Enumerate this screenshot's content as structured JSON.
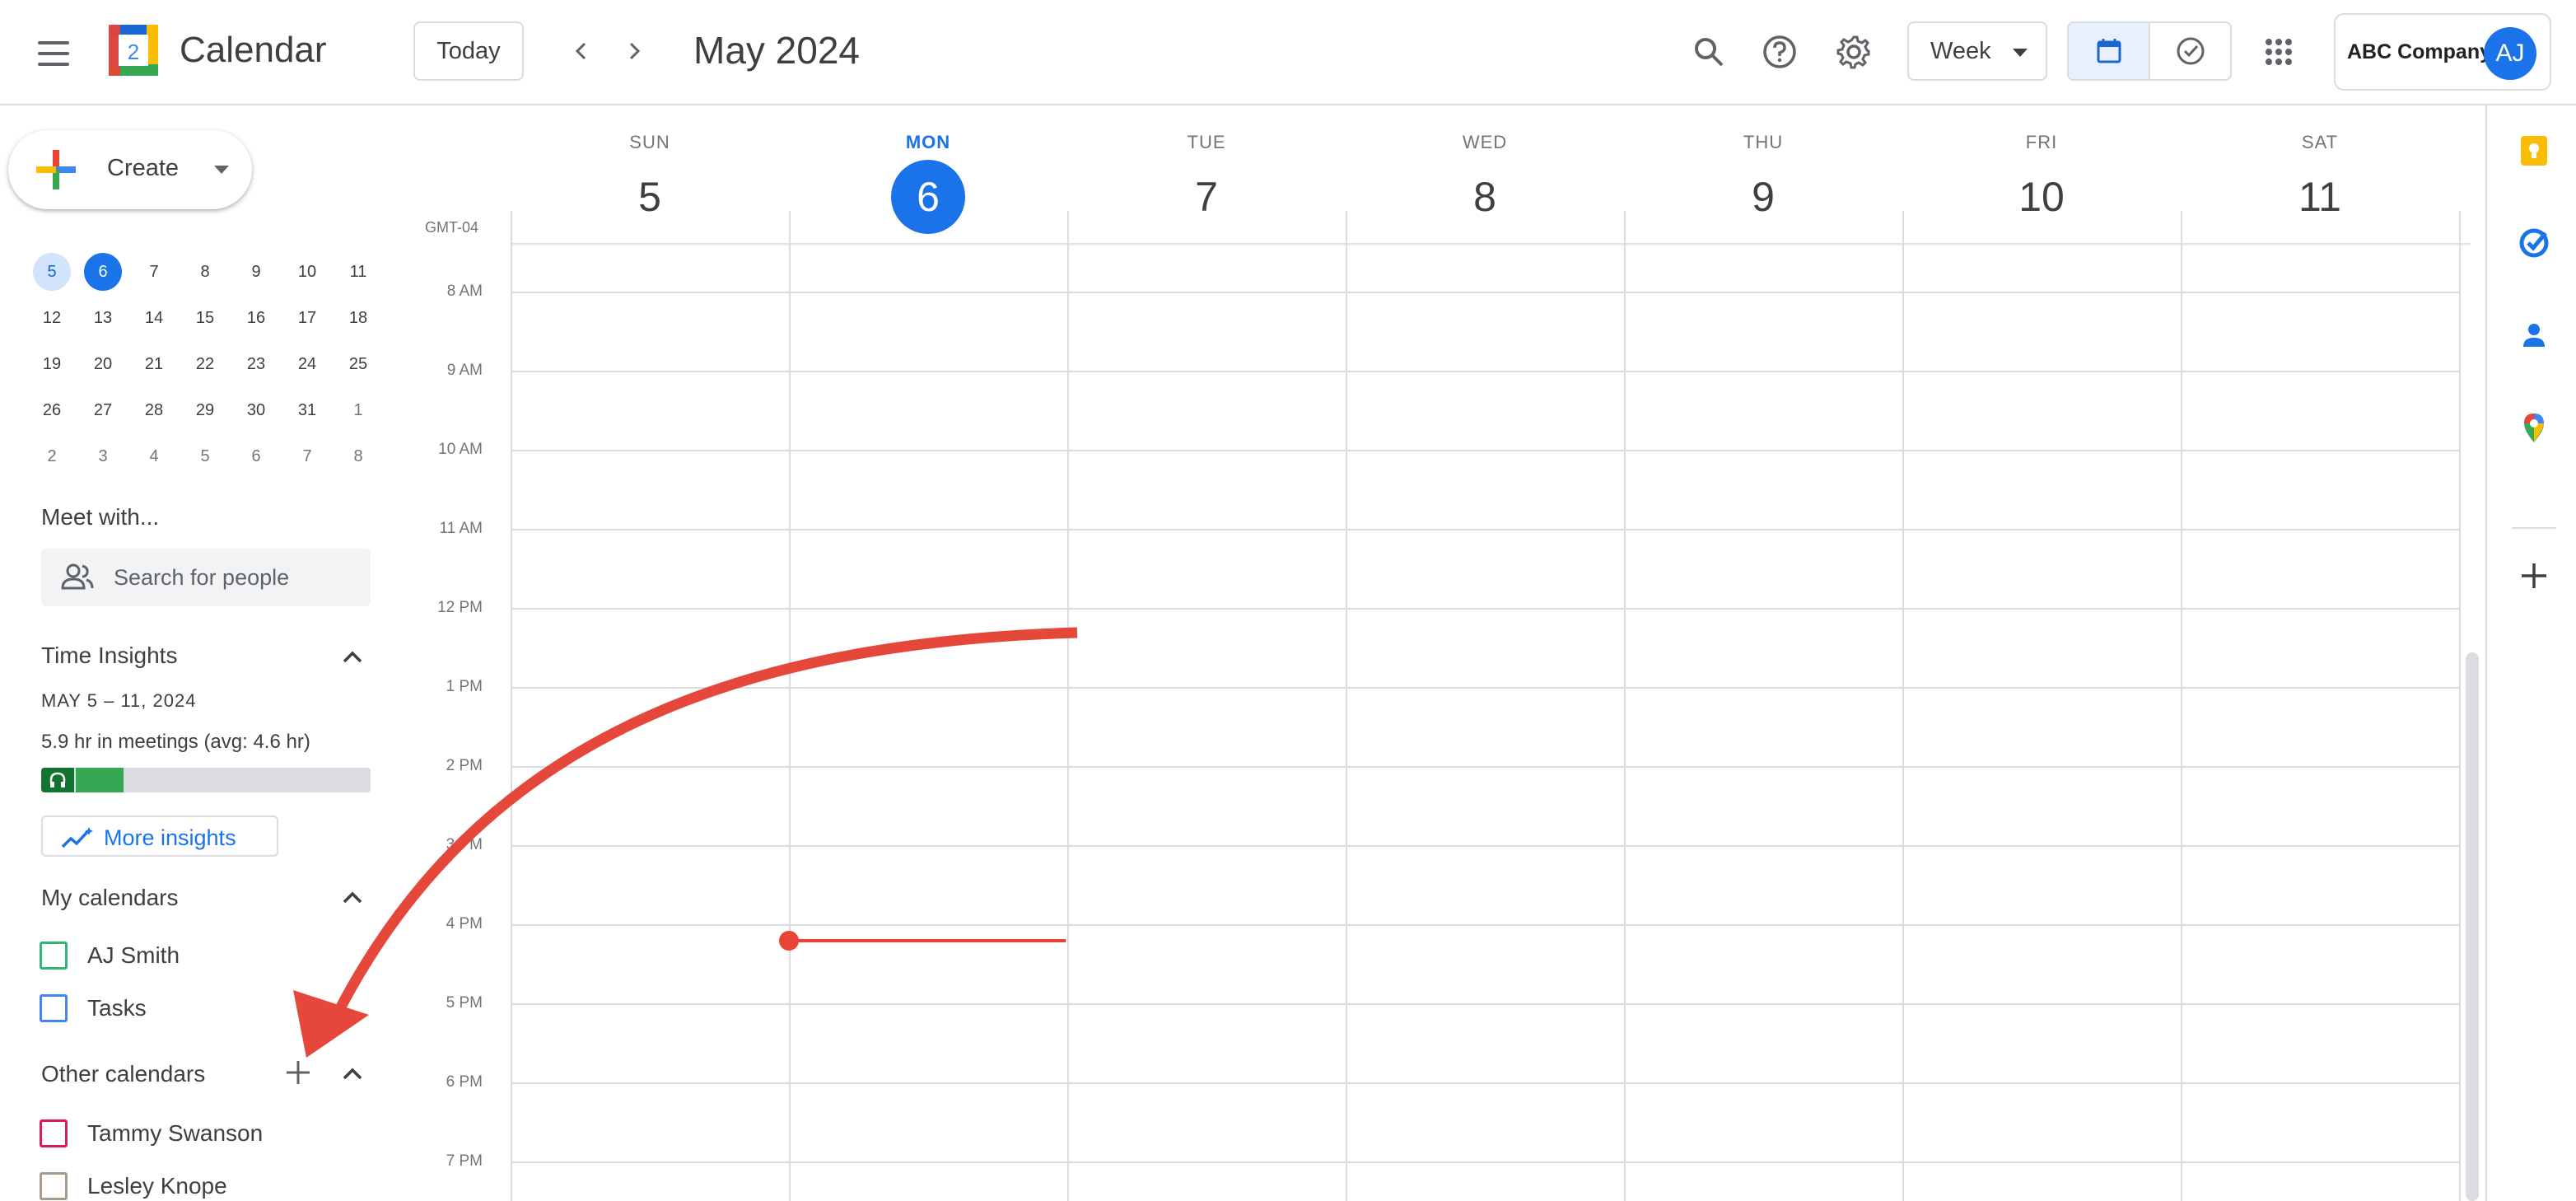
{
  "header": {
    "app_name": "Calendar",
    "logo_day": "2",
    "today_label": "Today",
    "month_title": "May 2024",
    "view_label": "Week",
    "account_org": "ABC Company",
    "account_initials": "AJ"
  },
  "sidebar": {
    "create_label": "Create",
    "mini_calendar": [
      [
        "5",
        "6",
        "7",
        "8",
        "9",
        "10",
        "11"
      ],
      [
        "12",
        "13",
        "14",
        "15",
        "16",
        "17",
        "18"
      ],
      [
        "19",
        "20",
        "21",
        "22",
        "23",
        "24",
        "25"
      ],
      [
        "26",
        "27",
        "28",
        "29",
        "30",
        "31",
        "1"
      ],
      [
        "2",
        "3",
        "4",
        "5",
        "6",
        "7",
        "8"
      ]
    ],
    "meet_with_title": "Meet with...",
    "search_people_placeholder": "Search for people",
    "time_insights": {
      "title": "Time Insights",
      "date_range": "MAY 5 – 11, 2024",
      "meetings_text": "5.9 hr in meetings (avg: 4.6 hr)",
      "more_insights_label": "More insights"
    },
    "my_calendars": {
      "title": "My calendars",
      "items": [
        {
          "name": "AJ Smith",
          "color": "#33b679"
        },
        {
          "name": "Tasks",
          "color": "#4285f4"
        }
      ]
    },
    "other_calendars": {
      "title": "Other calendars",
      "items": [
        {
          "name": "Tammy Swanson",
          "color": "#d81b60"
        },
        {
          "name": "Lesley Knope",
          "color": "#a79b8e"
        }
      ]
    }
  },
  "week": {
    "timezone": "GMT-04",
    "days": [
      {
        "name": "SUN",
        "num": "5"
      },
      {
        "name": "MON",
        "num": "6"
      },
      {
        "name": "TUE",
        "num": "7"
      },
      {
        "name": "WED",
        "num": "8"
      },
      {
        "name": "THU",
        "num": "9"
      },
      {
        "name": "FRI",
        "num": "10"
      },
      {
        "name": "SAT",
        "num": "11"
      }
    ],
    "hours": [
      "8 AM",
      "9 AM",
      "10 AM",
      "11 AM",
      "12 PM",
      "1 PM",
      "2 PM",
      "3 PM",
      "4 PM",
      "5 PM",
      "6 PM",
      "7 PM"
    ]
  },
  "colors": {
    "accent": "#1a73e8",
    "current_time": "#ea4335",
    "annotation_arrow": "#e5483a"
  }
}
